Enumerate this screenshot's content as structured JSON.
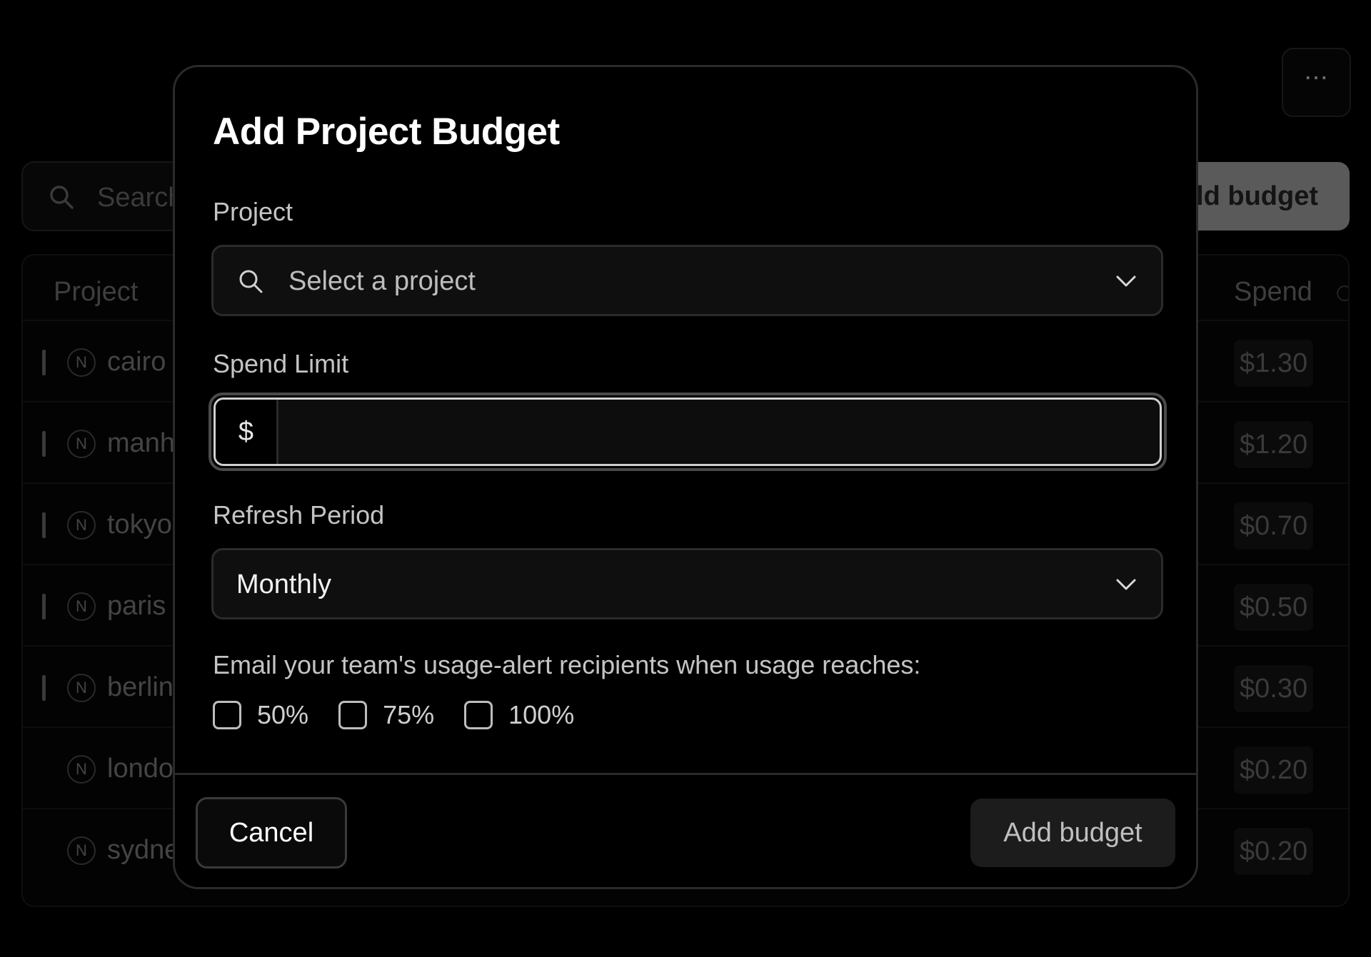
{
  "background": {
    "search_placeholder": "Search",
    "add_button_label": "Add budget",
    "more_icon": "⋯",
    "columns": {
      "project": "Project",
      "spend": "Spend"
    },
    "rows": [
      {
        "name": "cairo",
        "spend": "$1.30",
        "marker": true
      },
      {
        "name": "manhattan",
        "spend": "$1.20",
        "marker": true
      },
      {
        "name": "tokyo",
        "spend": "$0.70",
        "marker": true
      },
      {
        "name": "paris",
        "spend": "$0.50",
        "marker": true
      },
      {
        "name": "berlin",
        "spend": "$0.30",
        "marker": true
      },
      {
        "name": "london",
        "spend": "$0.20",
        "marker": false
      },
      {
        "name": "sydney",
        "spend": "$0.20",
        "marker": false
      }
    ]
  },
  "modal": {
    "title": "Add Project Budget",
    "project": {
      "label": "Project",
      "placeholder": "Select a project"
    },
    "spend_limit": {
      "label": "Spend Limit",
      "prefix": "$",
      "value": ""
    },
    "refresh_period": {
      "label": "Refresh Period",
      "value": "Monthly"
    },
    "alerts": {
      "label": "Email your team's usage-alert recipients when usage reaches:",
      "options": [
        {
          "label": "50%",
          "checked": false
        },
        {
          "label": "75%",
          "checked": false
        },
        {
          "label": "100%",
          "checked": false
        }
      ]
    },
    "footer": {
      "cancel_label": "Cancel",
      "submit_label": "Add budget"
    }
  }
}
